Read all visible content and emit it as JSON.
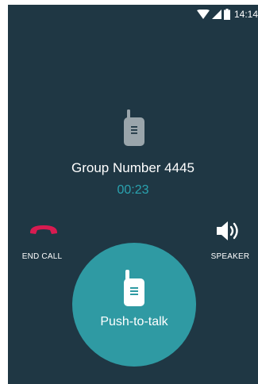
{
  "status_bar": {
    "time": "14:14",
    "icons": [
      "wifi-icon",
      "cell-signal-icon",
      "battery-icon"
    ]
  },
  "call": {
    "device_icon": "walkie-talkie-icon",
    "group_name": "Group Number 4445",
    "timer": "00:23"
  },
  "actions": {
    "end_call": {
      "label": "END CALL",
      "icon": "phone-hangup-icon",
      "color": "#d81b51"
    },
    "speaker": {
      "label": "SPEAKER",
      "icon": "speaker-icon"
    }
  },
  "push_to_talk": {
    "label": "Push-to-talk",
    "icon": "walkie-talkie-icon",
    "color": "#2f9aa3"
  },
  "colors": {
    "background": "#1f3744",
    "accent": "#2aa3b0"
  }
}
